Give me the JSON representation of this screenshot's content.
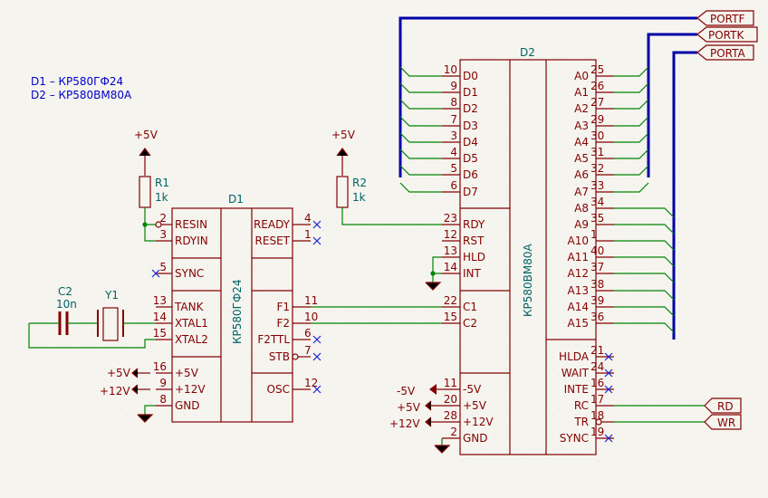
{
  "notes": [
    "D1 – КР580ГФ24",
    "D2 – КР580ВМ80А"
  ],
  "d1": {
    "ref": "D1",
    "part": "КР580ГФ24",
    "left_pins": [
      {
        "num": "2",
        "name": "RESIN"
      },
      {
        "num": "3",
        "name": "RDYIN"
      },
      {
        "num": "5",
        "name": "SYNC"
      },
      {
        "num": "13",
        "name": "TANK"
      },
      {
        "num": "14",
        "name": "XTAL1"
      },
      {
        "num": "15",
        "name": "XTAL2"
      },
      {
        "num": "16",
        "name": "+5V"
      },
      {
        "num": "9",
        "name": "+12V"
      },
      {
        "num": "8",
        "name": "GND"
      }
    ],
    "right_pins": [
      {
        "num": "4",
        "name": "READY"
      },
      {
        "num": "1",
        "name": "RESET"
      },
      {
        "num": "11",
        "name": "F1"
      },
      {
        "num": "10",
        "name": "F2"
      },
      {
        "num": "6",
        "name": "F2TTL"
      },
      {
        "num": "7",
        "name": "STB"
      },
      {
        "num": "12",
        "name": "OSC"
      }
    ]
  },
  "d2": {
    "ref": "D2",
    "part": "КР580ВМ80А",
    "data_pins": [
      {
        "num": "10",
        "name": "D0"
      },
      {
        "num": "9",
        "name": "D1"
      },
      {
        "num": "8",
        "name": "D2"
      },
      {
        "num": "7",
        "name": "D3"
      },
      {
        "num": "3",
        "name": "D4"
      },
      {
        "num": "4",
        "name": "D5"
      },
      {
        "num": "5",
        "name": "D6"
      },
      {
        "num": "6",
        "name": "D7"
      }
    ],
    "ctrl_pins": [
      {
        "num": "23",
        "name": "RDY"
      },
      {
        "num": "12",
        "name": "RST"
      },
      {
        "num": "13",
        "name": "HLD"
      },
      {
        "num": "14",
        "name": "INT"
      }
    ],
    "clk_pins": [
      {
        "num": "22",
        "name": "C1"
      },
      {
        "num": "15",
        "name": "C2"
      }
    ],
    "power_pins": [
      {
        "num": "11",
        "name": "-5V"
      },
      {
        "num": "20",
        "name": "+5V"
      },
      {
        "num": "28",
        "name": "+12V"
      },
      {
        "num": "2",
        "name": "GND"
      }
    ],
    "addr_pins": [
      {
        "num": "25",
        "name": "A0"
      },
      {
        "num": "26",
        "name": "A1"
      },
      {
        "num": "27",
        "name": "A2"
      },
      {
        "num": "29",
        "name": "A3"
      },
      {
        "num": "30",
        "name": "A4"
      },
      {
        "num": "31",
        "name": "A5"
      },
      {
        "num": "32",
        "name": "A6"
      },
      {
        "num": "33",
        "name": "A7"
      },
      {
        "num": "34",
        "name": "A8"
      },
      {
        "num": "35",
        "name": "A9"
      },
      {
        "num": "1",
        "name": "A10"
      },
      {
        "num": "40",
        "name": "A11"
      },
      {
        "num": "37",
        "name": "A12"
      },
      {
        "num": "38",
        "name": "A13"
      },
      {
        "num": "39",
        "name": "A14"
      },
      {
        "num": "36",
        "name": "A15"
      }
    ],
    "status_pins": [
      {
        "num": "21",
        "name": "HLDA"
      },
      {
        "num": "24",
        "name": "WAIT"
      },
      {
        "num": "16",
        "name": "INTE"
      },
      {
        "num": "17",
        "name": "RC"
      },
      {
        "num": "18",
        "name": "TR"
      },
      {
        "num": "19",
        "name": "SYNC"
      }
    ]
  },
  "r1": {
    "ref": "R1",
    "value": "1k",
    "supply": "+5V"
  },
  "r2": {
    "ref": "R2",
    "value": "1k",
    "supply": "+5V"
  },
  "c2": {
    "ref": "C2",
    "value": "10n"
  },
  "y1": {
    "ref": "Y1"
  },
  "d1_power": {
    "p5": "+5V",
    "p12": "+12V"
  },
  "d2_power": {
    "m5": "-5V",
    "p5": "+5V",
    "p12": "+12V"
  },
  "ports": [
    "PORTF",
    "PORTK",
    "PORTA"
  ],
  "signals": [
    "RD",
    "WR"
  ],
  "colors": {
    "component": "#840000",
    "wire": "#008400",
    "bus": "#0000a8",
    "no_connect": "#2020d0",
    "note": "#0000c8",
    "ref": "#006464",
    "background": "#f5f4ef"
  }
}
